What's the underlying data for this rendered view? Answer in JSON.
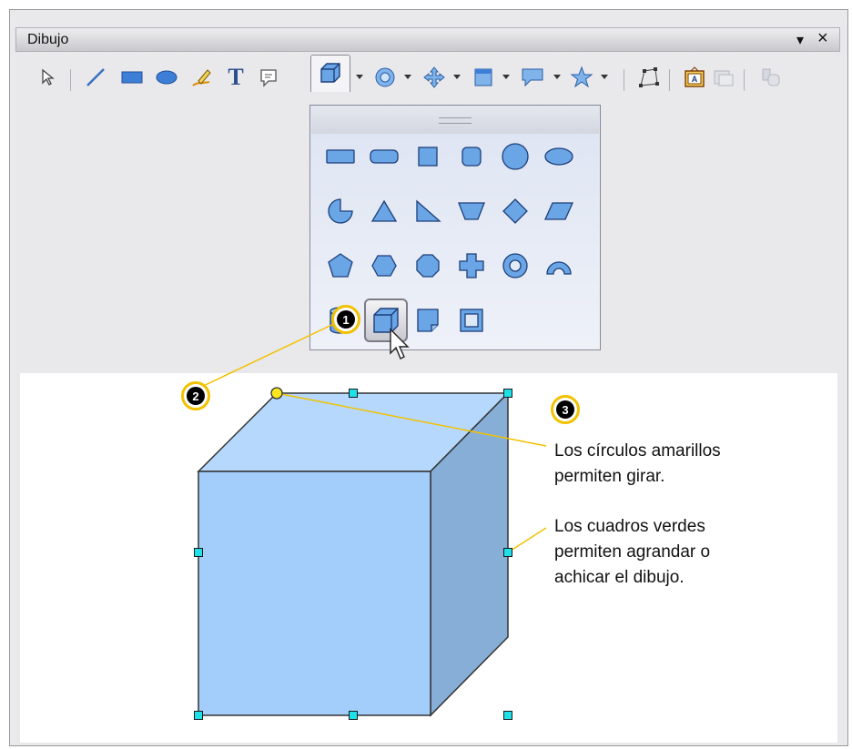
{
  "window": {
    "title": "Dibujo",
    "menu_arrow": "▾",
    "close_glyph": "×"
  },
  "toolbar": {
    "tools": [
      {
        "name": "select-tool",
        "icon": "arrow-pointer-icon"
      },
      {
        "name": "line-tool",
        "icon": "line-icon"
      },
      {
        "name": "rectangle-tool",
        "icon": "rectangle-icon"
      },
      {
        "name": "ellipse-tool",
        "icon": "ellipse-icon"
      },
      {
        "name": "freeform-tool",
        "icon": "pencil-icon"
      },
      {
        "name": "text-tool",
        "icon": "text-T-icon",
        "glyph": "T"
      },
      {
        "name": "callout-tool",
        "icon": "speech-bubble-icon"
      },
      {
        "name": "3d-shapes-tool",
        "icon": "cube-icon"
      },
      {
        "name": "symbol-shapes-tool",
        "icon": "symbol-icon"
      },
      {
        "name": "block-arrows-tool",
        "icon": "block-arrows-icon"
      },
      {
        "name": "flowchart-tool",
        "icon": "flowchart-icon"
      },
      {
        "name": "callouts-tool",
        "icon": "callout-bubble-icon"
      },
      {
        "name": "stars-tool",
        "icon": "star-icon"
      },
      {
        "name": "points-tool",
        "icon": "points-icon"
      },
      {
        "name": "fontwork-tool",
        "icon": "fontwork-icon",
        "glyph": "A"
      },
      {
        "name": "from-file-tool",
        "icon": "image-icon"
      },
      {
        "name": "extrusion-tool",
        "icon": "extrusion-icon"
      }
    ]
  },
  "shapes_popup": {
    "rows": [
      [
        "rectangle",
        "rounded-rectangle",
        "square",
        "rounded-square",
        "circle",
        "ellipse"
      ],
      [
        "circle-pie",
        "isosceles-triangle",
        "right-triangle",
        "trapezoid",
        "diamond",
        "parallelogram"
      ],
      [
        "pentagon",
        "hexagon",
        "octagon",
        "cross",
        "ring",
        "block-arc"
      ],
      [
        "cylinder",
        "cube",
        "folded-corner",
        "frame"
      ]
    ],
    "selected": "cube"
  },
  "badges": {
    "one": "1",
    "two": "2",
    "three": "3"
  },
  "notes": {
    "rotate_line1": "Los círculos amarillos",
    "rotate_line2": "permiten girar.",
    "resize_line1": "Los cuadros verdes",
    "resize_line2": "permiten agrandar o",
    "resize_line3": "achicar el dibujo."
  },
  "colors": {
    "accent_yellow": "#f2c100",
    "handle_cyan": "#1ee0e8",
    "cube_front": "#a3cdfb",
    "cube_top": "#b5d8fc",
    "cube_side": "#86aed6"
  }
}
